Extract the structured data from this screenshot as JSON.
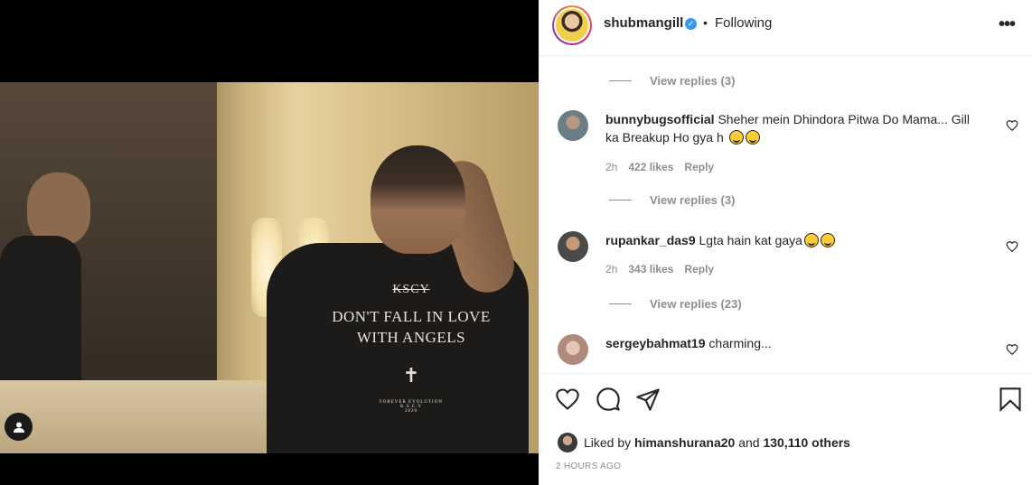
{
  "header": {
    "username": "shubmangill",
    "separator": "•",
    "follow_status": "Following",
    "verified_icon": "verified-badge",
    "more_icon": "•••"
  },
  "media": {
    "shirt_brand": "KSCY",
    "shirt_slogan_line1": "DON'T FALL IN LOVE",
    "shirt_slogan_line2": "WITH ANGELS",
    "shirt_cross": "✝",
    "shirt_small_line1": "FOREVER EVOLUTION",
    "shirt_small_line2": "K.S.C.Y",
    "shirt_small_line3": "2020"
  },
  "comments": {
    "top_view_replies": "View replies (3)",
    "items": [
      {
        "username": "bunnybugsofficial",
        "text": "Sheher mein Dhindora Pitwa Do Mama... Gill ka Breakup Ho gya h",
        "emojis": [
          "smiling-face-with-halo",
          "grinning-squinting-face"
        ],
        "time": "2h",
        "likes": "422 likes",
        "reply": "Reply",
        "view_replies": "View replies (3)"
      },
      {
        "username": "rupankar_das9",
        "text": "Lgta hain kat gaya",
        "emojis": [
          "grinning-squinting-face",
          "grinning-squinting-face"
        ],
        "time": "2h",
        "likes": "343 likes",
        "reply": "Reply",
        "view_replies": "View replies (23)"
      },
      {
        "username": "sergeybahmat19",
        "text": "charming..."
      }
    ]
  },
  "actions": {
    "liked_by_prefix": "Liked by",
    "liked_by_user": "himanshurana20",
    "liked_by_and": "and",
    "liked_by_others": "130,110 others",
    "timestamp": "2 HOURS AGO"
  }
}
